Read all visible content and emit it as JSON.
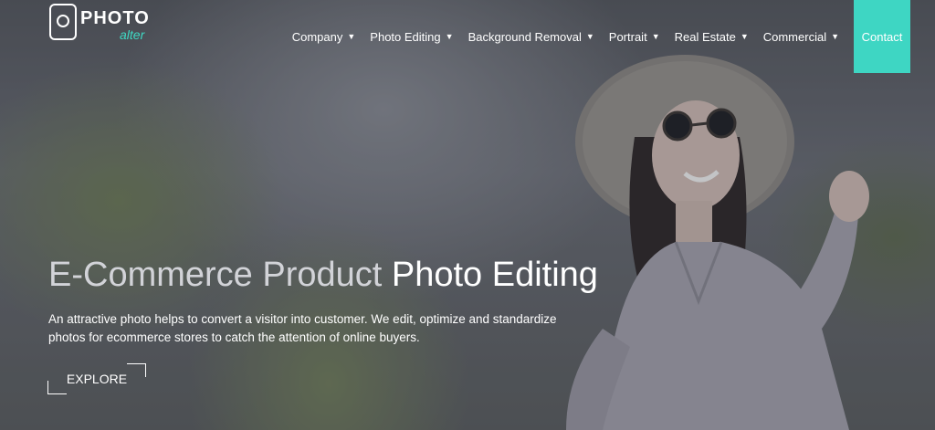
{
  "brand": {
    "logo_word": "PHOTO",
    "logo_sub": "alter",
    "accent_color": "#3ed6c3"
  },
  "nav": {
    "items": [
      {
        "label": "Company",
        "icon": "caret-down-icon"
      },
      {
        "label": "Photo Editing",
        "icon": "caret-down-icon"
      },
      {
        "label": "Background Removal",
        "icon": "caret-down-icon"
      },
      {
        "label": "Portrait",
        "icon": "caret-down-icon"
      },
      {
        "label": "Real Estate",
        "icon": "caret-down-icon"
      },
      {
        "label": "Commercial",
        "icon": "caret-down-icon"
      }
    ],
    "contact_label": "Contact"
  },
  "hero": {
    "title_part1": "E-Commerce Product ",
    "title_part2": "Photo Editing",
    "description": "An attractive photo helps to convert a visitor into customer. We edit, optimize and standardize photos for ecommerce stores to catch the attention of online buyers.",
    "cta_label": "EXPLORE"
  }
}
